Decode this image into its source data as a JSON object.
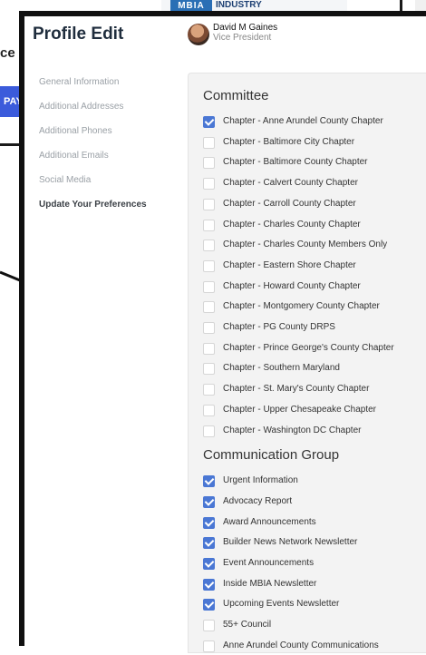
{
  "background": {
    "logo_text": "INDUSTRY",
    "logo_mark": "MBIA",
    "heading_fragment": "ce",
    "pay_button_fragment": "PAY"
  },
  "modal": {
    "title": "Profile Edit",
    "user": {
      "name": "David M Gaines",
      "role": "Vice President"
    },
    "nav": [
      {
        "label": "General Information",
        "active": false
      },
      {
        "label": "Additional Addresses",
        "active": false
      },
      {
        "label": "Additional Phones",
        "active": false
      },
      {
        "label": "Additional Emails",
        "active": false
      },
      {
        "label": "Social Media",
        "active": false
      },
      {
        "label": "Update Your Preferences",
        "active": true
      }
    ],
    "sections": [
      {
        "title": "Committee",
        "items": [
          {
            "label": "Chapter - Anne Arundel County Chapter",
            "checked": true
          },
          {
            "label": "Chapter - Baltimore City Chapter",
            "checked": false
          },
          {
            "label": "Chapter - Baltimore County Chapter",
            "checked": false
          },
          {
            "label": "Chapter - Calvert County Chapter",
            "checked": false
          },
          {
            "label": "Chapter - Carroll County Chapter",
            "checked": false
          },
          {
            "label": "Chapter - Charles County Chapter",
            "checked": false
          },
          {
            "label": "Chapter - Charles County Members Only",
            "checked": false
          },
          {
            "label": "Chapter - Eastern Shore Chapter",
            "checked": false
          },
          {
            "label": "Chapter - Howard County Chapter",
            "checked": false
          },
          {
            "label": "Chapter - Montgomery County Chapter",
            "checked": false
          },
          {
            "label": "Chapter - PG County DRPS",
            "checked": false
          },
          {
            "label": "Chapter - Prince George's County Chapter",
            "checked": false
          },
          {
            "label": "Chapter - Southern Maryland",
            "checked": false
          },
          {
            "label": "Chapter - St. Mary's County Chapter",
            "checked": false
          },
          {
            "label": "Chapter - Upper Chesapeake Chapter",
            "checked": false
          },
          {
            "label": "Chapter - Washington DC Chapter",
            "checked": false
          }
        ]
      },
      {
        "title": "Communication Group",
        "items": [
          {
            "label": "Urgent Information",
            "checked": true
          },
          {
            "label": "Advocacy Report",
            "checked": true
          },
          {
            "label": "Award Announcements",
            "checked": true
          },
          {
            "label": "Builder News Network Newsletter",
            "checked": true
          },
          {
            "label": "Event Announcements",
            "checked": true
          },
          {
            "label": "Inside MBIA Newsletter",
            "checked": true
          },
          {
            "label": "Upcoming Events Newsletter",
            "checked": true
          },
          {
            "label": "55+ Council",
            "checked": false
          },
          {
            "label": "Anne Arundel County Communications",
            "checked": false
          }
        ]
      }
    ]
  },
  "colors": {
    "checkbox_checked": "#4a77d4",
    "panel_bg": "#f3f3f3",
    "pay_button": "#3b5bdb"
  }
}
